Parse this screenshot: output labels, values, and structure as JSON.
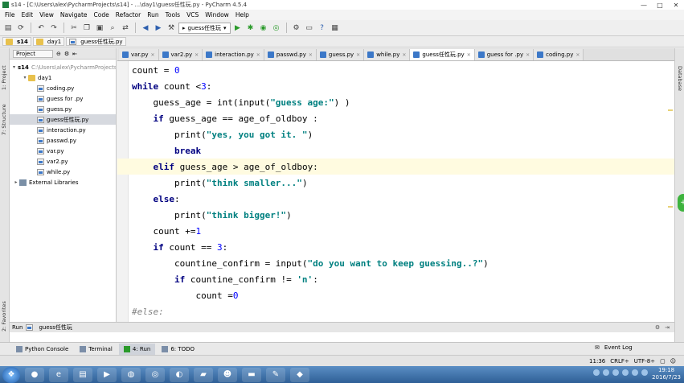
{
  "window": {
    "title": "s14 - [C:\\Users\\alex\\PycharmProjects\\s14] - ...\\day1\\guess任性玩.py - PyCharm 4.5.4",
    "minimize": "—",
    "maximize": "□",
    "close": "✕"
  },
  "menu": [
    "File",
    "Edit",
    "View",
    "Navigate",
    "Code",
    "Refactor",
    "Run",
    "Tools",
    "VCS",
    "Window",
    "Help"
  ],
  "toolbar": {
    "run_config": "guess任性玩",
    "icons": [
      "save-icon",
      "sync-icon",
      "undo-icon",
      "redo-icon",
      "cut-icon",
      "copy-icon",
      "paste-icon",
      "find-icon",
      "replace-icon",
      "back-icon",
      "forward-icon",
      "build-icon",
      "run-icon",
      "debug-icon",
      "coverage-icon",
      "profile-icon",
      "settings-icon",
      "help-icon",
      "terminal-icon"
    ]
  },
  "breadcrumbs": [
    "s14",
    "day1",
    "guess任性玩.py"
  ],
  "project": {
    "header": "Project",
    "tree": [
      {
        "label": "s14",
        "path": "C:\\Users\\alex\\PycharmProjects\\s14",
        "type": "folder",
        "depth": 0,
        "expanded": true
      },
      {
        "label": "day1",
        "type": "folder",
        "depth": 1,
        "expanded": true
      },
      {
        "label": "coding.py",
        "type": "file",
        "depth": 2
      },
      {
        "label": "guess for .py",
        "type": "file",
        "depth": 2
      },
      {
        "label": "guess.py",
        "type": "file",
        "depth": 2
      },
      {
        "label": "guess任性玩.py",
        "type": "file",
        "depth": 2,
        "selected": true
      },
      {
        "label": "interaction.py",
        "type": "file",
        "depth": 2
      },
      {
        "label": "passwd.py",
        "type": "file",
        "depth": 2
      },
      {
        "label": "var.py",
        "type": "file",
        "depth": 2
      },
      {
        "label": "var2.py",
        "type": "file",
        "depth": 2
      },
      {
        "label": "while.py",
        "type": "file",
        "depth": 2
      },
      {
        "label": "External Libraries",
        "type": "lib",
        "depth": 0,
        "expanded": false
      }
    ]
  },
  "tabs": [
    {
      "label": "var.py",
      "active": false
    },
    {
      "label": "var2.py",
      "active": false
    },
    {
      "label": "interaction.py",
      "active": false
    },
    {
      "label": "passwd.py",
      "active": false
    },
    {
      "label": "guess.py",
      "active": false
    },
    {
      "label": "while.py",
      "active": false
    },
    {
      "label": "guess任性玩.py",
      "active": true
    },
    {
      "label": "guess for .py",
      "active": false
    },
    {
      "label": "coding.py",
      "active": false
    }
  ],
  "code": [
    [
      {
        "t": "count = ",
        "c": ""
      },
      {
        "t": "0",
        "c": "num"
      }
    ],
    [
      {
        "t": "while",
        "c": "kw"
      },
      {
        "t": " count <",
        "c": ""
      },
      {
        "t": "3",
        "c": "num"
      },
      {
        "t": ":",
        "c": ""
      }
    ],
    [
      {
        "t": "    guess_age = int(input(",
        "c": ""
      },
      {
        "t": "\"guess age:\"",
        "c": "str"
      },
      {
        "t": ") )",
        "c": ""
      }
    ],
    [
      {
        "t": "    ",
        "c": ""
      },
      {
        "t": "if",
        "c": "kw"
      },
      {
        "t": " guess_age == age_of_oldboy :",
        "c": ""
      }
    ],
    [
      {
        "t": "        print(",
        "c": ""
      },
      {
        "t": "\"yes, you got it. \"",
        "c": "str"
      },
      {
        "t": ")",
        "c": ""
      }
    ],
    [
      {
        "t": "        ",
        "c": ""
      },
      {
        "t": "break",
        "c": "kw"
      }
    ],
    [
      {
        "t": "    ",
        "c": ""
      },
      {
        "t": "elif",
        "c": "kw"
      },
      {
        "t": " guess_age > age_of_oldboy:",
        "c": ""
      }
    ],
    [
      {
        "t": "        print(",
        "c": ""
      },
      {
        "t": "\"think smaller...\"",
        "c": "str"
      },
      {
        "t": ")",
        "c": ""
      }
    ],
    [
      {
        "t": "    ",
        "c": ""
      },
      {
        "t": "else",
        "c": "kw"
      },
      {
        "t": ":",
        "c": ""
      }
    ],
    [
      {
        "t": "        print(",
        "c": ""
      },
      {
        "t": "\"think bigger!\"",
        "c": "str"
      },
      {
        "t": ")",
        "c": ""
      }
    ],
    [
      {
        "t": "    count +=",
        "c": ""
      },
      {
        "t": "1",
        "c": "num"
      }
    ],
    [
      {
        "t": "    ",
        "c": ""
      },
      {
        "t": "if",
        "c": "kw"
      },
      {
        "t": " count == ",
        "c": ""
      },
      {
        "t": "3",
        "c": "num"
      },
      {
        "t": ":",
        "c": ""
      }
    ],
    [
      {
        "t": "        countine_confirm = input(",
        "c": ""
      },
      {
        "t": "\"do you want to keep guessing..?\"",
        "c": "str"
      },
      {
        "t": ")",
        "c": ""
      }
    ],
    [
      {
        "t": "        ",
        "c": ""
      },
      {
        "t": "if",
        "c": "kw"
      },
      {
        "t": " countine_confirm != ",
        "c": ""
      },
      {
        "t": "'n'",
        "c": "str"
      },
      {
        "t": ":",
        "c": ""
      }
    ],
    [
      {
        "t": "            count =",
        "c": ""
      },
      {
        "t": "0",
        "c": "num"
      }
    ],
    [
      {
        "t": "#else:",
        "c": "cmt"
      }
    ]
  ],
  "run_panel": {
    "label": "Run",
    "config": "guess任性玩"
  },
  "bottom_tabs": [
    {
      "label": "Python Console",
      "active": false
    },
    {
      "label": "Terminal",
      "active": false
    },
    {
      "label": "4: Run",
      "active": true
    },
    {
      "label": "6: TODO",
      "active": false
    }
  ],
  "event_log": "Event Log",
  "status": {
    "position": "11:36",
    "line_sep": "CRLF÷",
    "encoding": "UTF-8÷"
  },
  "side_labels": {
    "project": "1: Project",
    "structure": "7: Structure",
    "favorites": "2: Favorites",
    "database": "Database"
  },
  "clock": {
    "time": "19:18",
    "date": "2016/7/23"
  }
}
